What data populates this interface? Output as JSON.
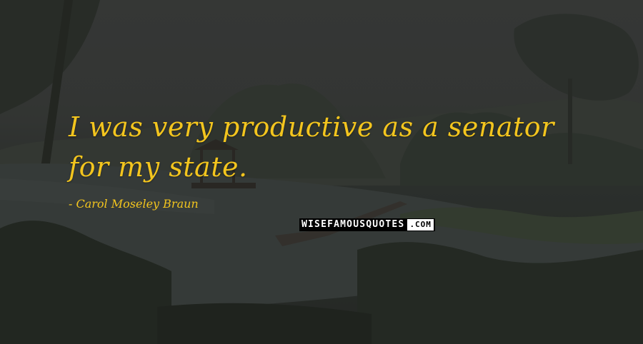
{
  "quote": {
    "text": "I was very productive as a senator for my state.",
    "author": "- Carol Moseley Braun"
  },
  "watermark": {
    "brand": "WISEFAMOUSQUOTES",
    "suffix": ".COM"
  },
  "colors": {
    "quote_text": "#f3c51e",
    "background_overlay": "#333733"
  }
}
